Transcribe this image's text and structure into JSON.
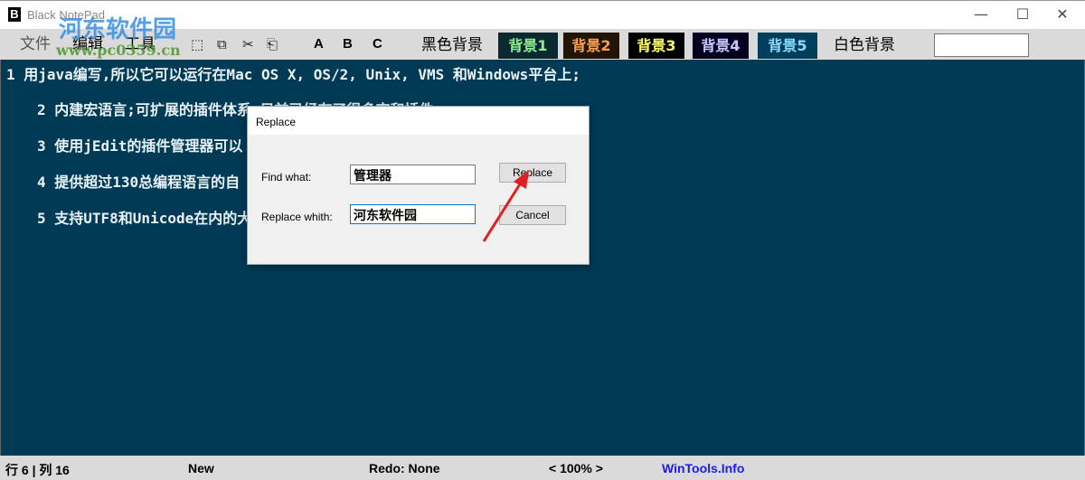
{
  "window": {
    "title": "Black NotePad",
    "icon": "B",
    "minimize": "—",
    "maximize": "☐",
    "close": "✕"
  },
  "watermark": {
    "text": "河东软件园",
    "url": "www.pc0359.cn"
  },
  "menu": {
    "file": "文件",
    "edit": "编辑",
    "tools": "工具"
  },
  "toolbar": {
    "select_all": "⬚",
    "copy": "⧉",
    "cut": "✂",
    "paste": "⎗",
    "a": "A",
    "b": "B",
    "c": "C",
    "search_value": ""
  },
  "themes": [
    {
      "label": "黑色背景",
      "bg": "#dadada",
      "fg": "#000000"
    },
    {
      "label": "背景1",
      "bg": "#0b2a30",
      "fg": "#8ef08e"
    },
    {
      "label": "背景2",
      "bg": "#221505",
      "fg": "#ffa050"
    },
    {
      "label": "背景3",
      "bg": "#000000",
      "fg": "#ffff66"
    },
    {
      "label": "背景4",
      "bg": "#05001e",
      "fg": "#c8c8ff"
    },
    {
      "label": "背景5",
      "bg": "#003f5c",
      "fg": "#8cd8ff"
    },
    {
      "label": "白色背景",
      "bg": "#dadada",
      "fg": "#000000"
    }
  ],
  "editor": {
    "lines": [
      "1 用java编写,所以它可以运行在Mac OS X, OS/2, Unix, VMS 和Windows平台上;",
      "2 内建宏语言;可扩展的插件体系,目前已经有了很多宏和插件.",
      "3 使用jEdit的插件管理器可以",
      "4 提供超过130总编程语言的自",
      "5 支持UTF8和Unicode在内的大"
    ]
  },
  "dialog": {
    "title": "Replace",
    "find_label": "Find what:",
    "find_value": "管理器",
    "replace_label": "Replace whith:",
    "replace_value": "河东软件园",
    "replace_button": "Replace",
    "cancel_button": "Cancel"
  },
  "status": {
    "position": "行 6 | 列 16",
    "state": "New",
    "redo": "Redo: None",
    "zoom": "< 100% >",
    "link": "WinTools.Info"
  }
}
